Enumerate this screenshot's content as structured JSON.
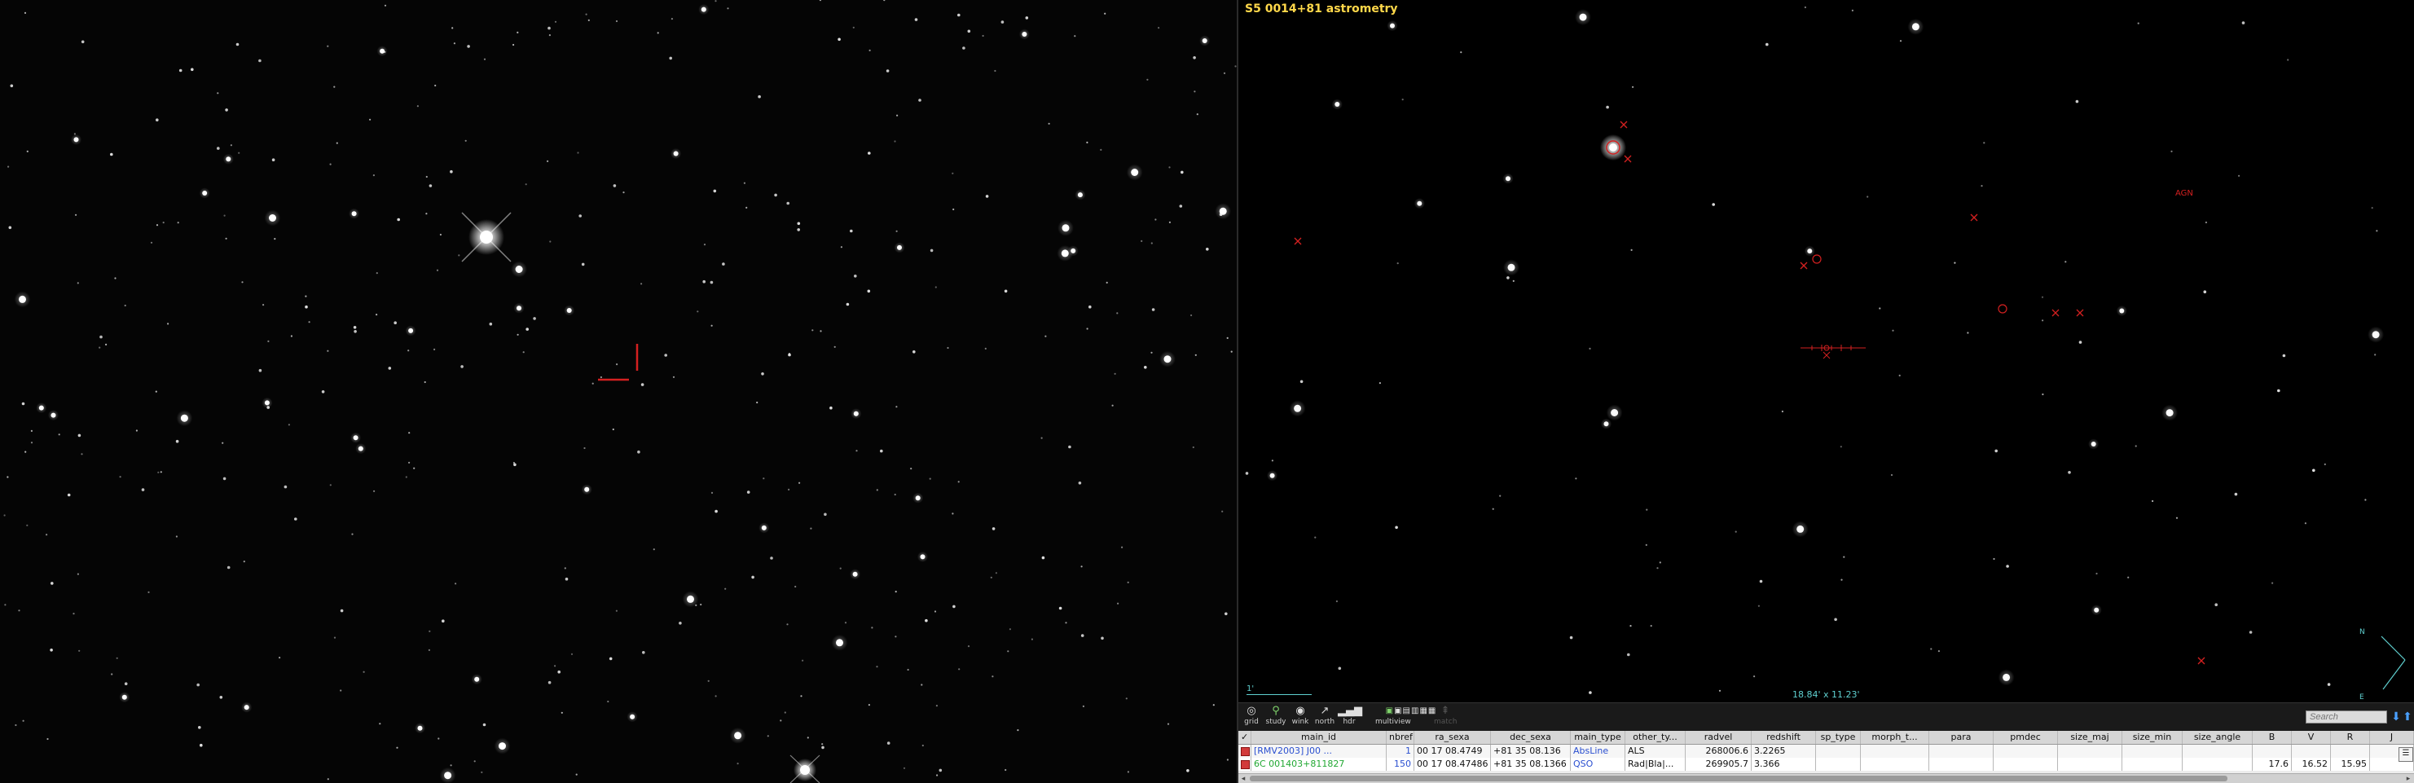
{
  "view": {
    "title": "S5 0014+81 astrometry",
    "fov": "18.84' x 11.23'",
    "scale": "1'"
  },
  "colors": {
    "title": "#ffd84a",
    "fov": "#5fd0d0",
    "marker": "#d42020",
    "link_blue": "#2a4fd0",
    "link_green": "#21a832"
  },
  "compass": {
    "north": "N",
    "east": "E"
  },
  "annotations": {
    "aladin_markers": [
      {
        "label": "AGN"
      }
    ]
  },
  "toolbar": {
    "tools": [
      {
        "name": "grid",
        "label": "grid",
        "icon": "grid-icon"
      },
      {
        "name": "study",
        "label": "study",
        "icon": "magnifier-icon"
      },
      {
        "name": "wink",
        "label": "wink",
        "icon": "eye-icon"
      },
      {
        "name": "north",
        "label": "north",
        "icon": "north-arrow-icon"
      },
      {
        "name": "hdr",
        "label": "hdr",
        "icon": "bars-icon"
      },
      {
        "name": "multiview",
        "label": "multiview",
        "icon": "multiview-icon"
      },
      {
        "name": "match",
        "label": "match",
        "icon": "match-icon",
        "disabled": true
      }
    ],
    "search_placeholder": "Search"
  },
  "table": {
    "columns": [
      "main_id",
      "nbref",
      "ra_sexa",
      "dec_sexa",
      "main_type",
      "other_ty...",
      "radvel",
      "redshift",
      "sp_type",
      "morph_t...",
      "para",
      "pmdec",
      "size_maj",
      "size_min",
      "size_angle",
      "B",
      "V",
      "R",
      "J"
    ],
    "rows": [
      {
        "main_id": "[RMV2003] J00 ...",
        "nbref": "1",
        "ra_sexa": "00 17 08.4749",
        "dec_sexa": "+81 35 08.136",
        "main_type": "AbsLine",
        "other_types": "ALS",
        "radvel": "268006.6",
        "redshift": "3.2265",
        "B": "",
        "V": "",
        "R": "",
        "J": ""
      },
      {
        "main_id": "6C 001403+811827",
        "nbref": "150",
        "ra_sexa": "00 17 08.47486",
        "dec_sexa": "+81 35 08.1366",
        "main_type": "QSO",
        "other_types": "Rad|Bla|...",
        "radvel": "269905.7",
        "redshift": "3.366",
        "B": "17.6",
        "V": "16.52",
        "R": "15.95",
        "J": ""
      }
    ]
  }
}
